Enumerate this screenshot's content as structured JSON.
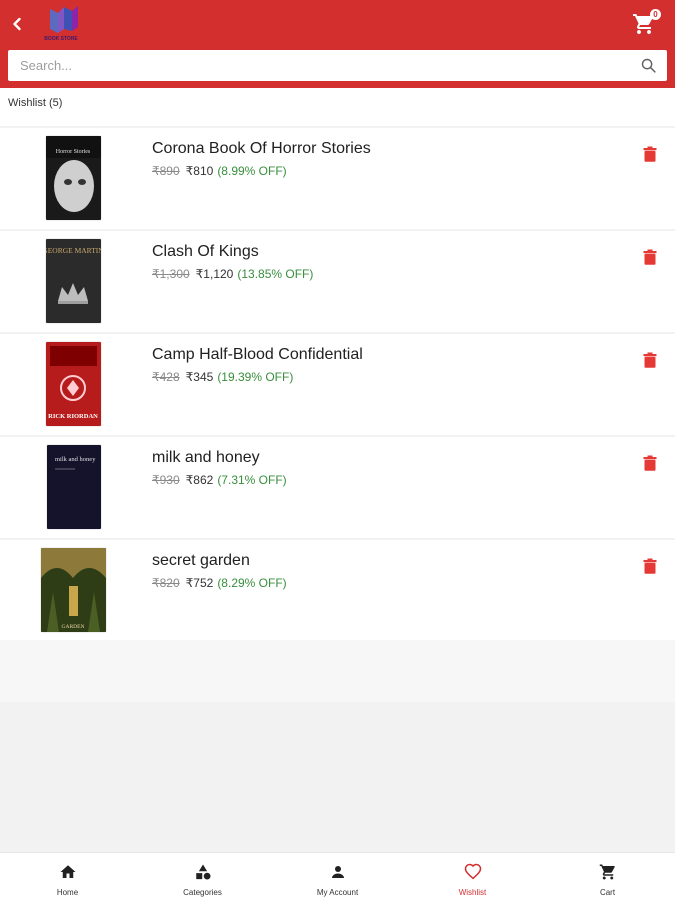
{
  "header": {
    "logo_text": "BOOK STORE",
    "cart_count": "0",
    "search_placeholder": "Search..."
  },
  "wishlist": {
    "title": "Wishlist (5)"
  },
  "items": [
    {
      "title": "Corona Book Of Horror Stories",
      "mrp": "₹890",
      "price": "₹810",
      "discount": "(8.99% OFF)",
      "cover_text": "Horror Stories"
    },
    {
      "title": "Clash Of Kings",
      "mrp": "₹1,300",
      "price": "₹1,120",
      "discount": "(13.85% OFF)",
      "cover_text": "GEORGE MARTIN"
    },
    {
      "title": "Camp Half-Blood Confidential",
      "mrp": "₹428",
      "price": "₹345",
      "discount": "(19.39% OFF)",
      "cover_text": "RICK RIORDAN"
    },
    {
      "title": "milk and honey",
      "mrp": "₹930",
      "price": "₹862",
      "discount": "(7.31% OFF)",
      "cover_text": "milk and honey"
    },
    {
      "title": "secret garden",
      "mrp": "₹820",
      "price": "₹752",
      "discount": "(8.29% OFF)",
      "cover_text": "GARDEN"
    }
  ],
  "bottom_nav": [
    {
      "label": "Home",
      "icon": "home-icon"
    },
    {
      "label": "Categories",
      "icon": "categories-icon"
    },
    {
      "label": "My Account",
      "icon": "account-icon"
    },
    {
      "label": "Wishlist",
      "icon": "heart-icon",
      "active": true
    },
    {
      "label": "Cart",
      "icon": "cart-icon"
    }
  ],
  "colors": {
    "primary": "#d32f2f",
    "discount": "#388e3c",
    "delete": "#e53935"
  }
}
